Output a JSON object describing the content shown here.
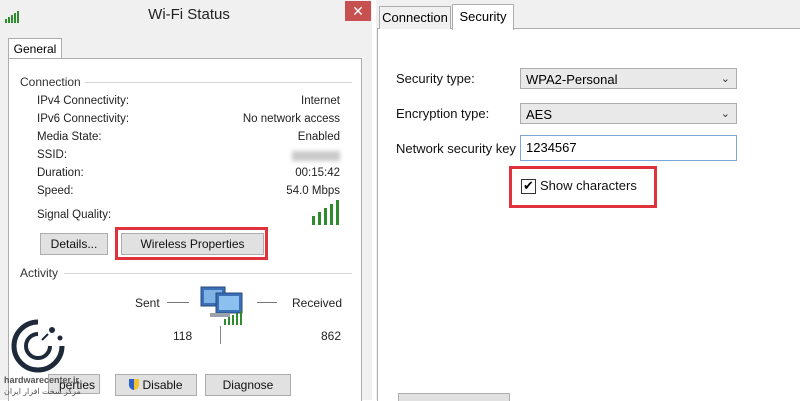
{
  "left_window": {
    "title": "Wi-Fi Status",
    "close_glyph": "✕",
    "tab_general": "General",
    "connection": {
      "group_label": "Connection",
      "rows": [
        {
          "label": "IPv4 Connectivity:",
          "value": "Internet"
        },
        {
          "label": "IPv6 Connectivity:",
          "value": "No network access"
        },
        {
          "label": "Media State:",
          "value": "Enabled"
        },
        {
          "label": "SSID:",
          "value": ""
        },
        {
          "label": "Duration:",
          "value": "00:15:42"
        },
        {
          "label": "Speed:",
          "value": "54.0 Mbps"
        }
      ],
      "signal_label": "Signal Quality:",
      "signal_bars": 5,
      "details_button": "Details...",
      "wireless_properties_button": "Wireless Properties"
    },
    "activity": {
      "group_label": "Activity",
      "sent_label": "Sent",
      "received_label": "Received",
      "sent_value": "118",
      "received_value": "862"
    },
    "bottom_buttons": {
      "properties": "perties",
      "disable": "Disable",
      "diagnose": "Diagnose"
    }
  },
  "right_window": {
    "tabs": [
      {
        "label": "Connection",
        "active": false
      },
      {
        "label": "Security",
        "active": true
      }
    ],
    "security_type_label": "Security type:",
    "security_type_value": "WPA2-Personal",
    "encryption_type_label": "Encryption type:",
    "encryption_type_value": "AES",
    "network_key_label": "Network security key",
    "network_key_value": "1234567",
    "show_characters_label": "Show characters",
    "show_characters_checked": true,
    "check_glyph": "✔",
    "chevron_glyph": "⌄"
  },
  "watermark": {
    "line1": "hardwarecenter.ir",
    "line2": "مرکز سخت افزار ایران"
  },
  "colors": {
    "highlight_red": "#e0323c",
    "signal_green": "#2e8b2e",
    "close_red": "#c75050"
  }
}
